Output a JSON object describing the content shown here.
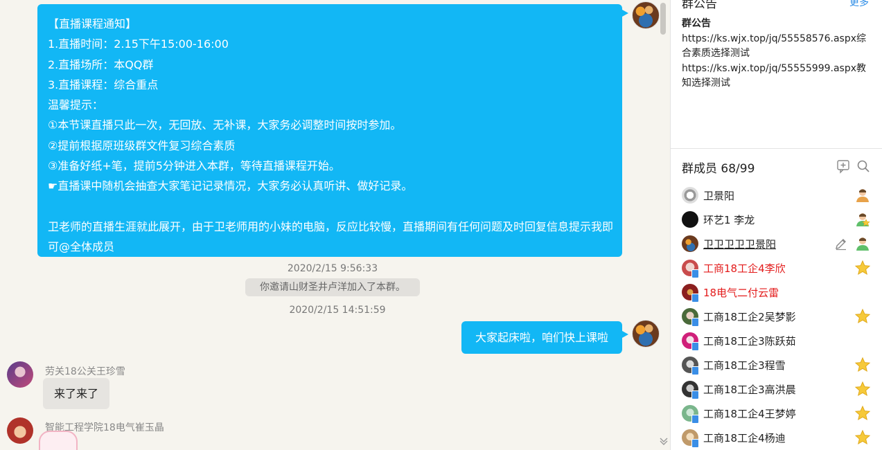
{
  "chat": {
    "notice": {
      "lines": [
        "【直播课程通知】",
        "1.直播时间：2.15下午15:00-16:00",
        "2.直播场所：本QQ群",
        "3.直播课程：综合重点",
        "温馨提示：",
        "①本节课直播只此一次，无回放、无补课，大家务必调整时间按时参加。",
        "②提前根据原班级群文件复习综合素质",
        "③准备好纸+笔，提前5分钟进入本群，等待直播课程开始。",
        "☛直播课中随机会抽查大家笔记记录情况，大家务必认真听讲、做好记录。"
      ],
      "closing": "卫老师的直播生涯就此展开，由于卫老师用的小妹的电脑，反应比较慢，直播期间有任何问题及时回复信息提示我即可@全体成员"
    },
    "time1": "2020/2/15 9:56:33",
    "system_msg": "你邀请山财圣井卢洋加入了本群。",
    "time2": "2020/2/15 14:51:59",
    "my_msg": "大家起床啦，咱们快上课啦",
    "msg_other1": {
      "sender": "劳关18公关王珍雪",
      "text": "来了来了"
    },
    "msg_other2": {
      "sender": "智能工程学院18电气崔玉晶"
    }
  },
  "side": {
    "announcement": {
      "title": "群公告",
      "more": "更多",
      "heading": "群公告",
      "lines": [
        "https://ks.wjx.top/jq/55558576.aspx综",
        "合素质选择测试",
        "https://ks.wjx.top/jq/55555999.aspx教",
        "知选择测试"
      ]
    },
    "members": {
      "title": "群成员 68/99",
      "list": [
        {
          "name": "卫景阳",
          "style": "normal",
          "role": "owner"
        },
        {
          "name": "环艺1  李龙",
          "style": "normal",
          "role": "admin"
        },
        {
          "name": "卫卫卫卫卫景阳",
          "style": "underline",
          "role": "self"
        },
        {
          "name": "工商18工企4李欣",
          "style": "red",
          "role": "star"
        },
        {
          "name": "18电气二付云雷",
          "style": "red",
          "role": "none"
        },
        {
          "name": "工商18工企2吴梦影",
          "style": "normal",
          "role": "star"
        },
        {
          "name": "工商18工企3陈跃茹",
          "style": "normal",
          "role": "none"
        },
        {
          "name": "工商18工企3程雪",
          "style": "normal",
          "role": "star"
        },
        {
          "name": "工商18工企3高洪晨",
          "style": "normal",
          "role": "star"
        },
        {
          "name": "工商18工企4王梦婷",
          "style": "normal",
          "role": "star"
        },
        {
          "name": "工商18工企4杨迪",
          "style": "normal",
          "role": "star"
        }
      ]
    }
  },
  "colors": {
    "bubble_blue": "#12b7f5",
    "name_red": "#e31b1b",
    "star_yellow": "#f6c93a",
    "link_blue": "#2a8be6"
  },
  "icons": [
    "add-member-icon",
    "search-icon",
    "owner-icon",
    "admin-icon",
    "edit-icon",
    "star-icon",
    "mobile-online-icon",
    "scroll-down-icon"
  ]
}
